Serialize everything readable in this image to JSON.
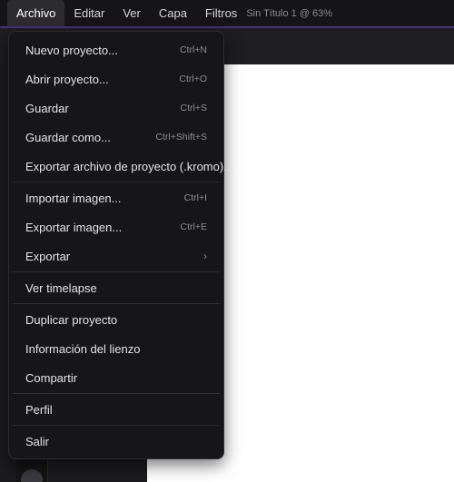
{
  "menubar": {
    "items": [
      {
        "label": "Archivo"
      },
      {
        "label": "Editar"
      },
      {
        "label": "Ver"
      },
      {
        "label": "Capa"
      },
      {
        "label": "Filtros"
      }
    ],
    "doc_title": "Sin Título 1 @ 63%"
  },
  "file_menu": {
    "groups": [
      [
        {
          "label": "Nuevo proyecto...",
          "shortcut": "Ctrl+N"
        },
        {
          "label": "Abrir proyecto...",
          "shortcut": "Ctrl+O"
        },
        {
          "label": "Guardar",
          "shortcut": "Ctrl+S"
        },
        {
          "label": "Guardar como...",
          "shortcut": "Ctrl+Shift+S"
        },
        {
          "label": "Exportar archivo de proyecto (.kromo)...",
          "shortcut": ""
        }
      ],
      [
        {
          "label": "Importar imagen...",
          "shortcut": "Ctrl+I"
        },
        {
          "label": "Exportar imagen...",
          "shortcut": "Ctrl+E"
        },
        {
          "label": "Exportar",
          "shortcut": "",
          "submenu": true
        }
      ],
      [
        {
          "label": "Ver timelapse",
          "shortcut": ""
        }
      ],
      [
        {
          "label": "Duplicar proyecto",
          "shortcut": ""
        },
        {
          "label": "Información del lienzo",
          "shortcut": ""
        },
        {
          "label": "Compartir",
          "shortcut": ""
        }
      ],
      [
        {
          "label": "Perfil",
          "shortcut": ""
        }
      ],
      [
        {
          "label": "Salir",
          "shortcut": ""
        }
      ]
    ]
  },
  "colors": {
    "accent": "#4b2f86",
    "menu_bg": "#161618",
    "canvas": "#ffffff"
  }
}
